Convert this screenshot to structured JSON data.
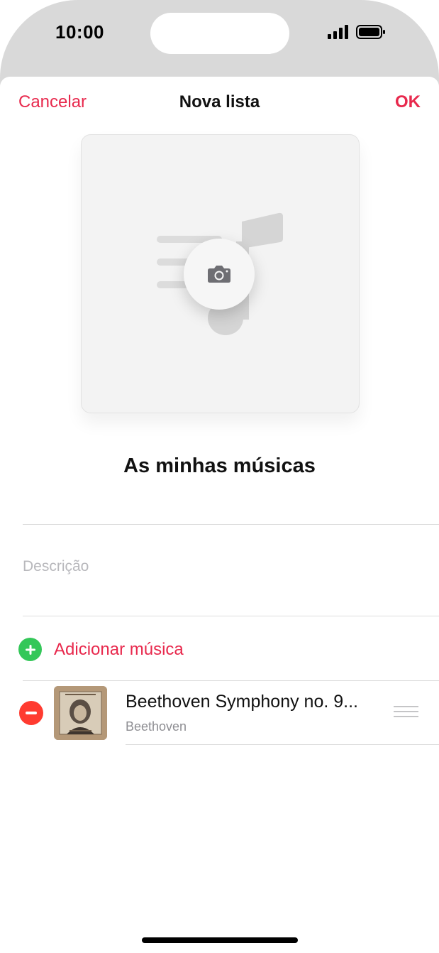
{
  "status_bar": {
    "time": "10:00"
  },
  "nav": {
    "cancel_label": "Cancelar",
    "title": "Nova lista",
    "ok_label": "OK"
  },
  "artwork": {
    "camera_icon": "camera-icon"
  },
  "playlist": {
    "name": "As minhas músicas",
    "description_placeholder": "Descrição"
  },
  "add_song": {
    "label": "Adicionar música"
  },
  "songs": [
    {
      "title": "Beethoven Symphony no. 9...",
      "artist": "Beethoven"
    }
  ],
  "colors": {
    "accent": "#e8294d",
    "add": "#34c759",
    "remove": "#ff3b30"
  }
}
